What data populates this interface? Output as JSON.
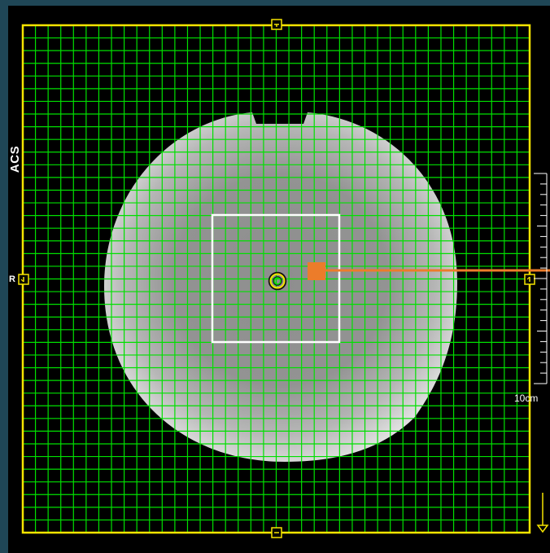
{
  "viewport": {
    "orientation_label": "ACS",
    "side_label": "R",
    "scale_label": "10cm"
  },
  "colors": {
    "background": "#000000",
    "frame": "#f5e400",
    "grid": "#00e000",
    "roi_box": "#ffffff",
    "marker": "#ec7c2a",
    "scale": "#ffffff",
    "panel_border": "#1f4656"
  },
  "icons": {
    "top_handle": "square-handle-icon",
    "bottom_handle": "square-handle-icon",
    "left_handle": "square-handle-icon",
    "right_handle": "square-handle-icon",
    "center": "isocenter-icon",
    "scroll": "down-arrow-icon"
  }
}
